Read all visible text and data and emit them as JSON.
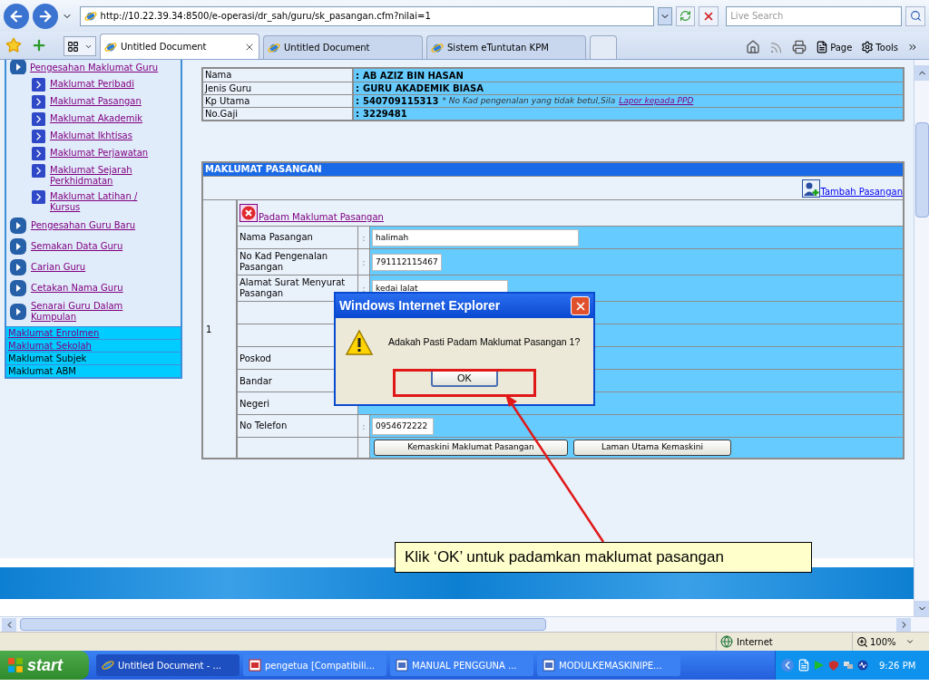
{
  "browser": {
    "address": "http://10.22.39.34:8500/e-operasi/dr_sah/guru/sk_pasangan.cfm?nilai=1",
    "search_placeholder": "Live Search",
    "tabs": [
      {
        "label": "Untitled Document",
        "selected": true
      },
      {
        "label": "Untitled Document",
        "selected": false
      },
      {
        "label": "Sistem eTuntutan KPM",
        "selected": false
      }
    ],
    "toolbar": [
      "Page",
      "Tools"
    ]
  },
  "sidebar": {
    "group": {
      "label": "Pengesahan Maklumat Guru",
      "children": [
        "Maklumat Peribadi",
        "Maklumat Pasangan",
        "Maklumat Akademik",
        "Maklumat Ikhtisas",
        "Maklumat Perjawatan",
        "Maklumat Sejarah Perkhidmatan",
        "Maklumat Latihan / Kursus"
      ]
    },
    "items": [
      "Pengesahan Guru Baru",
      "Semakan Data Guru",
      "Carian Guru",
      "Cetakan Nama Guru",
      "Senarai Guru Dalam Kumpulan"
    ],
    "menus": [
      {
        "label": "Maklumat Enrolmen",
        "link": true
      },
      {
        "label": "Maklumat Sekolah",
        "link": true
      },
      {
        "label": "Maklumat Subjek",
        "link": false
      },
      {
        "label": "Maklumat ABM",
        "link": false
      }
    ]
  },
  "info": [
    {
      "label": "Nama",
      "colon": ":",
      "value": "AB AZIZ BIN HASAN"
    },
    {
      "label": "Jenis Guru",
      "colon": ":",
      "value": "GURU AKADEMIK BIASA"
    },
    {
      "label": "Kp Utama",
      "colon": ":",
      "value": "540709115313",
      "note": "* No Kad pengenalan yang tidak betul,Sila",
      "link": "Lapor kepada PPD"
    },
    {
      "label": "No.Gaji",
      "colon": ":",
      "value": "3229481"
    }
  ],
  "section": {
    "title": "MAKLUMAT PASANGAN",
    "add_link": "Tambah Pasangan",
    "delete_link": "Padam Maklumat Pasangan",
    "number": "1",
    "rows": [
      {
        "kind": "input",
        "label": "Nama Pasangan",
        "colon": ":",
        "value": "halimah"
      },
      {
        "kind": "input",
        "label": "No Kad Pengenalan Pasangan",
        "colon": ":",
        "value": "791112115467"
      },
      {
        "kind": "input",
        "label": "Alamat Surat Menyurat Pasangan",
        "colon": ":",
        "value": "kedai lalat"
      },
      {
        "kind": "blank"
      },
      {
        "kind": "blank"
      },
      {
        "kind": "covered",
        "label": "Poskod"
      },
      {
        "kind": "covered",
        "label": "Bandar"
      },
      {
        "kind": "covered",
        "label": "Negeri"
      },
      {
        "kind": "input",
        "label": "No Telefon",
        "colon": ":",
        "value": "0954672222"
      }
    ],
    "buttons": [
      "Kemaskini Maklumat Pasangan",
      "Laman Utama Kemaskini"
    ]
  },
  "dialog": {
    "title": "Windows Internet Explorer",
    "message": "Adakah Pasti Padam Maklumat Pasangan 1?",
    "ok": "OK"
  },
  "callout": "Klik ‘OK’ untuk padamkan maklumat pasangan",
  "status": {
    "zone": "Internet",
    "zoom": "100%"
  },
  "taskbar": {
    "start": "start",
    "items": [
      "Untitled Document - ...",
      "pengetua [Compatibili...",
      "MANUAL PENGGUNA ...",
      "MODULKEMASKINIPE..."
    ],
    "clock": "9:26 PM"
  }
}
